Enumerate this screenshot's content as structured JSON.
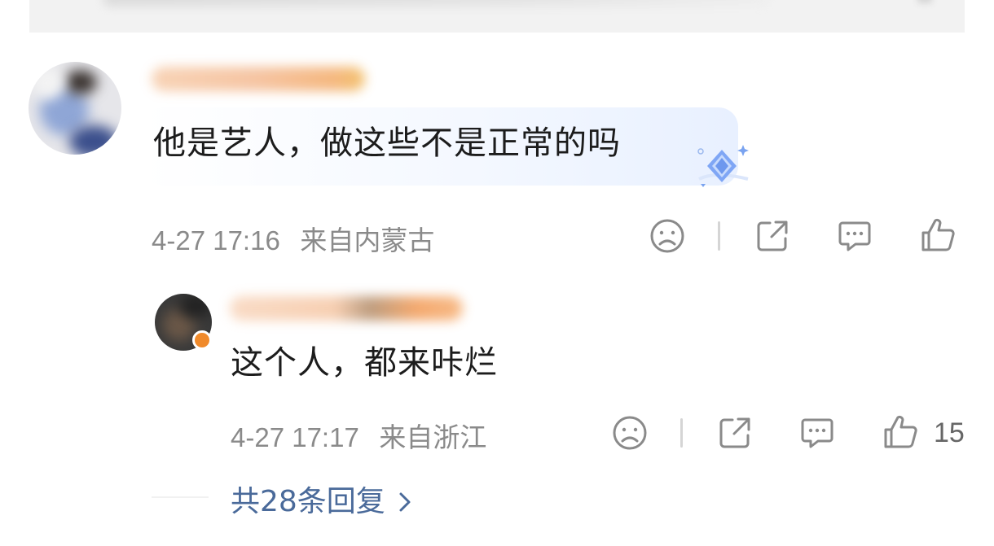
{
  "comment": {
    "text": "他是艺人，做这些不是正常的吗",
    "time": "4-27 17:16",
    "location": "来自内蒙古"
  },
  "reply": {
    "text": "这个人，都来咔烂",
    "time": "4-27 17:17",
    "location": "来自浙江",
    "like_count": "15"
  },
  "more_replies": {
    "label": "共28条回复"
  },
  "icons": {
    "dislike": "sad-face-icon",
    "share": "share-icon",
    "comment": "comment-icon",
    "like": "thumbs-up-icon",
    "badge": "diamond-badge-icon",
    "more": "chevron-right-icon"
  },
  "colors": {
    "link": "#4a6a9a",
    "meta": "#8a8a8a",
    "icon": "#8a8a8a"
  }
}
